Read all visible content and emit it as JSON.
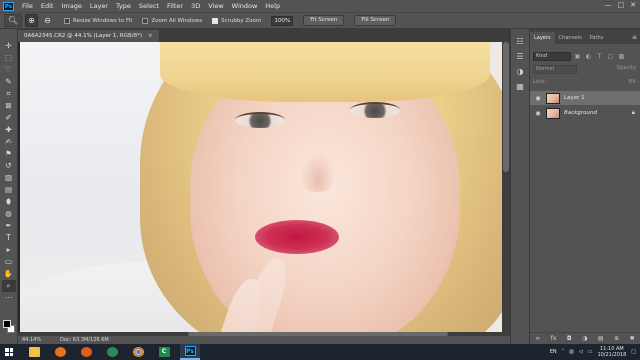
{
  "menubar": {
    "app_logo": "Ps",
    "items": [
      "File",
      "Edit",
      "Image",
      "Layer",
      "Type",
      "Select",
      "Filter",
      "3D",
      "View",
      "Window",
      "Help"
    ],
    "window_controls": [
      "—",
      "□",
      "✕"
    ]
  },
  "options": {
    "tool_icon": "zoom-tool-icon",
    "resize_windows_label": "Resize Windows to Fit",
    "resize_windows_checked": false,
    "zoom_all_windows_label": "Zoom All Windows",
    "zoom_all_windows_checked": false,
    "scrubby_zoom_label": "Scrubby Zoom",
    "scrubby_zoom_checked": true,
    "zoom_value": "100%",
    "fit_screen_label": "Fit Screen",
    "fill_screen_label": "Fill Screen"
  },
  "document": {
    "tab_title": "0A6A2345.CR2 @ 44.1% (Layer 1, RGB/8*)",
    "close_glyph": "×"
  },
  "status": {
    "zoom": "44.14%",
    "doc_size": "Doc: 63.3M/126.6M"
  },
  "panel": {
    "tabs": [
      "Layers",
      "Channels",
      "Paths"
    ],
    "active_tab": "Layers",
    "filter_kind": "Kind",
    "blend_mode": "Normal",
    "opacity_label": "Opacity:",
    "lock_label": "Lock:",
    "fill_label": "Fill:",
    "layers": [
      {
        "name": "Layer 1",
        "selected": true,
        "visible": true,
        "locked": false
      },
      {
        "name": "Background",
        "selected": false,
        "visible": true,
        "locked": true
      }
    ]
  },
  "taskbar": {
    "apps": [
      {
        "name": "file-explorer",
        "color": "#f1c24b",
        "active": false
      },
      {
        "name": "media-player",
        "color": "#e8731b",
        "active": false
      },
      {
        "name": "firefox",
        "color": "#e25c1d",
        "active": false
      },
      {
        "name": "network-app",
        "color": "#2e8b57",
        "active": false
      },
      {
        "name": "chrome",
        "color": "#3d8bdb",
        "active": false
      },
      {
        "name": "camtasia",
        "color": "#1f8b4c",
        "active": false
      },
      {
        "name": "photoshop",
        "color": "#31a8ff",
        "active": true
      }
    ],
    "ps_label": "Ps",
    "camtasia_label": "C",
    "language": "EN",
    "time": "11:10 AM",
    "date": "10/21/2018"
  },
  "colors": {
    "ps_blue": "#31a8ff",
    "ps_bg": "#535353"
  }
}
